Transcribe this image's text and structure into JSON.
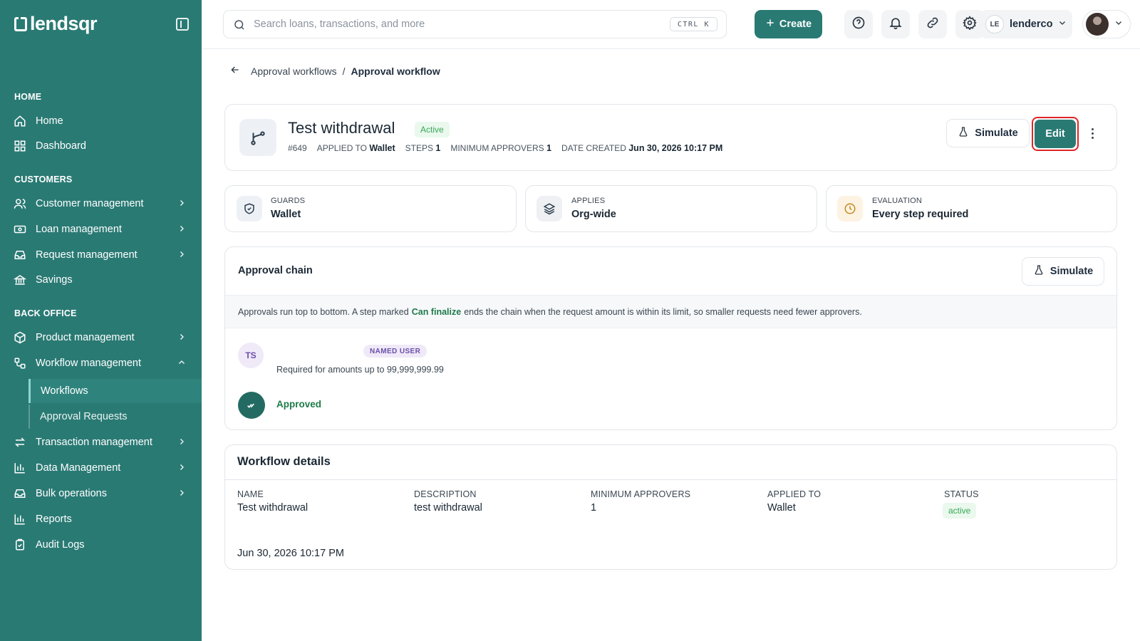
{
  "app": {
    "logo": "lendsqr"
  },
  "sidebar": {
    "sections": {
      "home": "HOME",
      "customers": "CUSTOMERS",
      "back_office": "BACK OFFICE"
    },
    "items": {
      "home": "Home",
      "dashboard": "Dashboard",
      "customer_management": "Customer management",
      "loan_management": "Loan management",
      "request_management": "Request management",
      "savings": "Savings",
      "product_management": "Product management",
      "workflow_management": "Workflow management",
      "workflows": "Workflows",
      "approval_requests": "Approval Requests",
      "transaction_management": "Transaction management",
      "data_management": "Data Management",
      "bulk_operations": "Bulk operations",
      "reports": "Reports",
      "audit_logs": "Audit Logs"
    },
    "active_item": "Workflows"
  },
  "header": {
    "search_placeholder": "Search loans, transactions, and more",
    "shortcut": "CTRL K",
    "create_label": "Create",
    "org_initials": "LE",
    "org_name": "lenderco"
  },
  "breadcrumb": {
    "parent": "Approval workflows",
    "separator": "/",
    "current": "Approval workflow"
  },
  "workflow": {
    "title": "Test withdrawal",
    "status_badge": "Active",
    "id": "#649",
    "applied_to_label": "APPLIED TO",
    "applied_to": "Wallet",
    "steps_label": "STEPS",
    "steps": "1",
    "min_approvers_label": "MINIMUM APPROVERS",
    "min_approvers": "1",
    "date_created_label": "DATE CREATED",
    "date_created": "Jun 30, 2026 10:17 PM",
    "simulate_label": "Simulate",
    "edit_label": "Edit"
  },
  "stats": {
    "guards_label": "GUARDS",
    "guards_value": "Wallet",
    "applies_label": "APPLIES",
    "applies_value": "Org-wide",
    "evaluation_label": "EVALUATION",
    "evaluation_value": "Every step required"
  },
  "chain": {
    "title": "Approval chain",
    "simulate_label": "Simulate",
    "note_before": "Approvals run top to bottom. A step marked",
    "note_highlight": "Can finalize",
    "note_after": "ends the chain when the request amount is within its limit, so smaller requests need fewer approvers.",
    "step": {
      "initials": "TS",
      "badge": "NAMED USER",
      "requirement": "Required for amounts up to 99,999,999.99"
    },
    "approved_label": "Approved"
  },
  "details": {
    "title": "Workflow details",
    "name_label": "NAME",
    "name_value": "Test withdrawal",
    "description_label": "DESCRIPTION",
    "description_value": "test withdrawal",
    "min_approvers_label": "MINIMUM APPROVERS",
    "min_approvers_value": "1",
    "applied_to_label": "APPLIED TO",
    "applied_to_value": "Wallet",
    "status_label": "STATUS",
    "status_value": "active",
    "date_value": "Jun 30, 2026 10:17 PM"
  },
  "colors": {
    "brand": "#2a7a74",
    "active_green": "#37a856",
    "highlight_red": "#e02424",
    "named_user_purple": "#6b4fa8"
  },
  "icons": {
    "home": "home-icon",
    "dashboard": "dashboard-icon",
    "customers": "users-icon",
    "loans": "loan-icon",
    "requests": "inbox-icon",
    "savings": "bank-icon",
    "products": "box-icon",
    "workflow": "workflow-icon",
    "transactions": "transfer-icon",
    "data": "bar-chart-icon",
    "bulk": "inbox-icon",
    "reports": "bar-chart-icon",
    "audit": "clipboard-icon"
  }
}
